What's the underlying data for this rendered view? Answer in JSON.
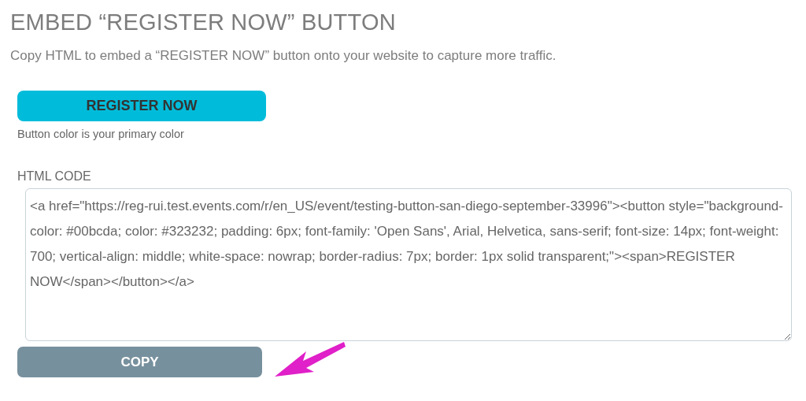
{
  "title": "EMBED “REGISTER NOW” BUTTON",
  "description": "Copy HTML to embed a “REGISTER NOW” button onto your website to capture more traffic.",
  "preview_button": {
    "label": "REGISTER NOW",
    "color": "#00bcda"
  },
  "preview_caption": "Button color is your primary color",
  "code_field": {
    "label": "HTML CODE",
    "value": "<a href=\"https://reg-rui.test.events.com/r/en_US/event/testing-button-san-diego-september-33996\"><button style=\"background-color: #00bcda; color: #323232; padding: 6px; font-family: 'Open Sans', Arial, Helvetica, sans-serif; font-size: 14px; font-weight: 700; vertical-align: middle; white-space: nowrap; border-radius: 7px; border: 1px solid transparent;\"><span>REGISTER NOW</span></button></a>"
  },
  "copy_button": {
    "label": "COPY"
  }
}
